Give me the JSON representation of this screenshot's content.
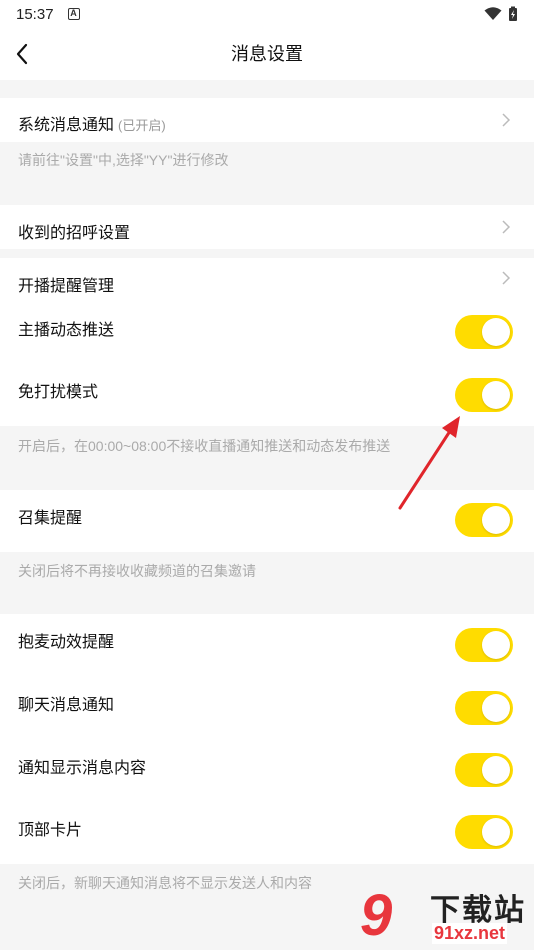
{
  "status_bar": {
    "time": "15:37",
    "notification_glyph": "A"
  },
  "app_bar": {
    "title": "消息设置"
  },
  "system_notify": {
    "label": "系统消息通知",
    "status": "(已开启)"
  },
  "system_hint": "请前往\"设置\"中,选择\"YY\"进行修改",
  "greeting_settings": {
    "label": "收到的招呼设置"
  },
  "live_reminder": {
    "label": "开播提醒管理"
  },
  "anchor_push": {
    "label": "主播动态推送",
    "on": true
  },
  "dnd_mode": {
    "label": "免打扰模式",
    "on": true
  },
  "dnd_hint": "开启后，在00:00~08:00不接收直播通知推送和动态发布推送",
  "summon_reminder": {
    "label": "召集提醒",
    "on": true
  },
  "summon_hint": "关闭后将不再接收收藏频道的召集邀请",
  "mic_effect": {
    "label": "抱麦动效提醒",
    "on": true
  },
  "chat_notify": {
    "label": "聊天消息通知",
    "on": true
  },
  "show_content": {
    "label": "通知显示消息内容",
    "on": true
  },
  "top_card": {
    "label": "顶部卡片",
    "on": true
  },
  "bottom_hint": "关闭后，新聊天通知消息将不显示发送人和内容",
  "watermark": {
    "logo": "9",
    "title": "下载站",
    "url": "91xz.net"
  },
  "colors": {
    "toggle_on": "#ffdc00",
    "background": "#f5f5f5",
    "hint_text": "#aaaaaa",
    "arrow": "#e0252b"
  }
}
